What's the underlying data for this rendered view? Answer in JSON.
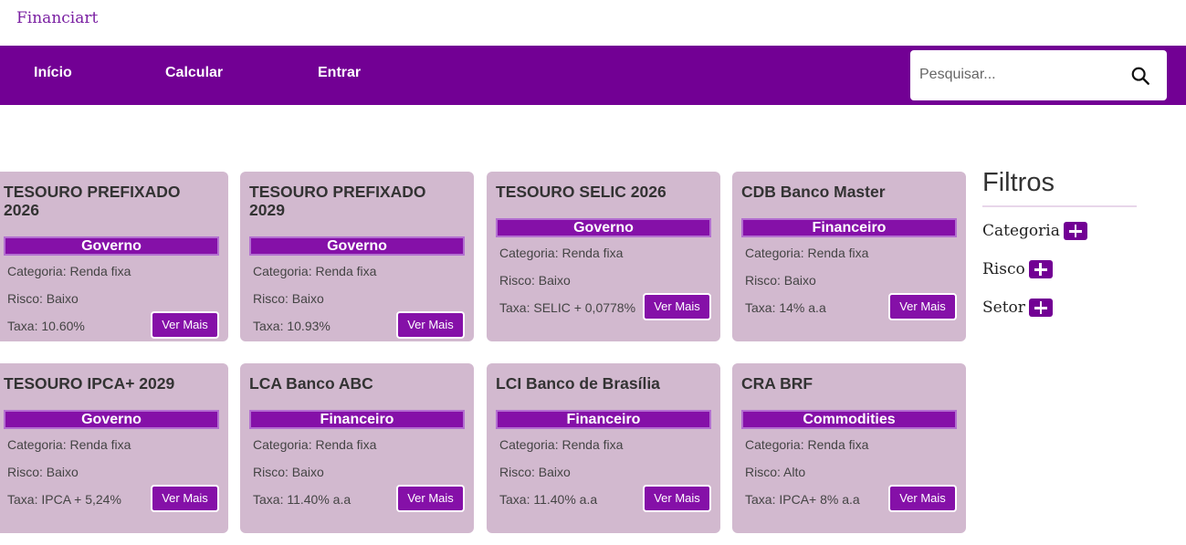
{
  "brand": "Financiart",
  "nav": {
    "links": [
      "Início",
      "Calcular",
      "Entrar"
    ],
    "search_placeholder": "Pesquisar..."
  },
  "cards": [
    {
      "title": "TESOURO PREFIXADO 2026",
      "tag": "Governo",
      "category": "Categoria: Renda fixa",
      "risk": "Risco: Baixo",
      "rate": "Taxa: 10.60%",
      "button": "Ver Mais"
    },
    {
      "title": "TESOURO PREFIXADO 2029",
      "tag": "Governo",
      "category": "Categoria: Renda fixa",
      "risk": "Risco: Baixo",
      "rate": "Taxa: 10.93%",
      "button": "Ver Mais"
    },
    {
      "title": "TESOURO SELIC 2026",
      "tag": "Governo",
      "category": "Categoria: Renda fixa",
      "risk": "Risco: Baixo",
      "rate": "Taxa: SELIC + 0,0778%",
      "button": "Ver Mais"
    },
    {
      "title": "CDB Banco Master",
      "tag": "Financeiro",
      "category": "Categoria: Renda fixa",
      "risk": "Risco: Baixo",
      "rate": "Taxa: 14% a.a",
      "button": "Ver Mais"
    },
    {
      "title": "TESOURO IPCA+ 2029",
      "tag": "Governo",
      "category": "Categoria: Renda fixa",
      "risk": "Risco: Baixo",
      "rate": "Taxa: IPCA + 5,24%",
      "button": "Ver Mais"
    },
    {
      "title": "LCA Banco ABC",
      "tag": "Financeiro",
      "category": "Categoria: Renda fixa",
      "risk": "Risco: Baixo",
      "rate": "Taxa: 11.40% a.a",
      "button": "Ver Mais"
    },
    {
      "title": "LCI Banco de Brasília",
      "tag": "Financeiro",
      "category": "Categoria: Renda fixa",
      "risk": "Risco: Baixo",
      "rate": "Taxa: 11.40% a.a",
      "button": "Ver Mais"
    },
    {
      "title": "CRA BRF",
      "tag": "Commodities",
      "category": "Categoria: Renda fixa",
      "risk": "Risco: Alto",
      "rate": "Taxa: IPCA+ 8% a.a",
      "button": "Ver Mais"
    }
  ],
  "filters": {
    "title": "Filtros",
    "items": [
      "Categoria",
      "Risco",
      "Setor"
    ]
  },
  "colors": {
    "primary": "#720094",
    "tag": "#8510a8",
    "card_bg": "#d2b9cf",
    "brand": "#7a1fa2"
  }
}
